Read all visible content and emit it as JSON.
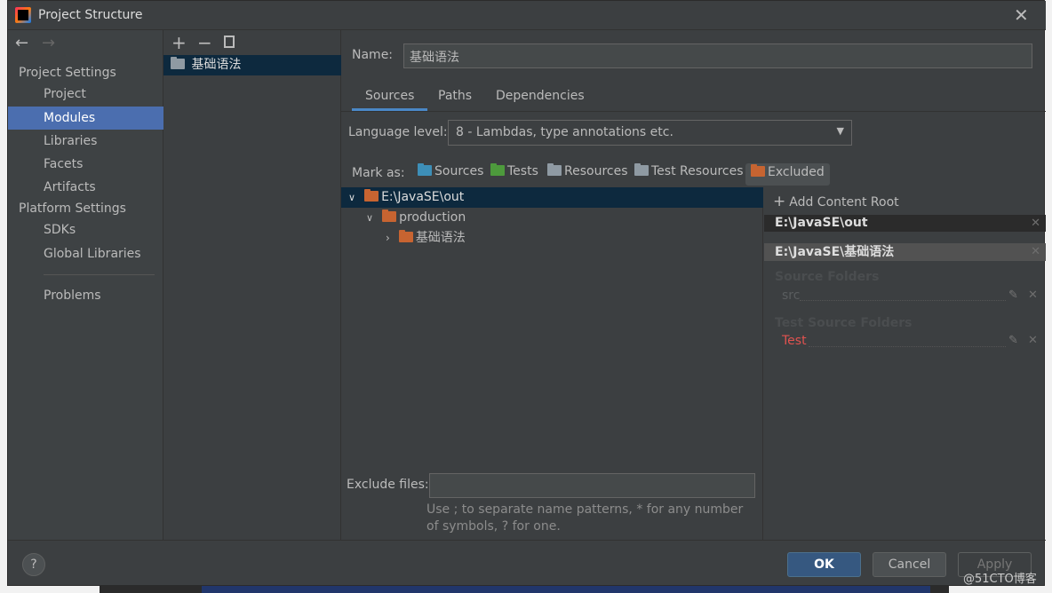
{
  "window": {
    "title": "Project Structure"
  },
  "sidebar": {
    "section1": "Project Settings",
    "items1": [
      "Project",
      "Modules",
      "Libraries",
      "Facets",
      "Artifacts"
    ],
    "section2": "Platform Settings",
    "items2": [
      "SDKs",
      "Global Libraries"
    ],
    "problems": "Problems",
    "selected": "Modules"
  },
  "modules": {
    "items": [
      "基础语法"
    ]
  },
  "main": {
    "name_label": "Name:",
    "name_value": "基础语法",
    "tabs": [
      "Sources",
      "Paths",
      "Dependencies"
    ],
    "active_tab": "Sources",
    "language_label": "Language level:",
    "language_value": "8 - Lambdas, type annotations etc.",
    "mark_as_label": "Mark as:",
    "mark_as": [
      {
        "label": "Sources",
        "color": "#3d8fb8"
      },
      {
        "label": "Tests",
        "color": "#4d9a3c"
      },
      {
        "label": "Resources",
        "color": "#8f9aa3"
      },
      {
        "label": "Test Resources",
        "color": "#8f9aa3"
      },
      {
        "label": "Excluded",
        "color": "#c76431"
      }
    ],
    "tree": [
      {
        "label": "E:\\JavaSE\\out",
        "expanded": true,
        "selected": true
      },
      {
        "label": "production",
        "expanded": true
      },
      {
        "label": "基础语法",
        "expanded": false
      }
    ],
    "exclude_label": "Exclude files:",
    "exclude_value": "",
    "exclude_hint": "Use ; to separate name patterns, * for any number of symbols, ? for one."
  },
  "roots": {
    "add_label": "Add Content Root",
    "items": [
      "E:\\JavaSE\\out",
      "E:\\JavaSE\\基础语法"
    ],
    "source_folders_label": "Source Folders",
    "source_folders": [
      "src"
    ],
    "test_folders_label": "Test Source Folders",
    "test_folders": [
      "Test"
    ]
  },
  "footer": {
    "help": "?",
    "ok": "OK",
    "cancel": "Cancel",
    "apply": "Apply"
  },
  "watermark": "@51CTO博客",
  "colors": {
    "accent": "#4b6eaf",
    "selection": "#0d293e",
    "excluded": "#c76431",
    "test": "#e0524f"
  }
}
